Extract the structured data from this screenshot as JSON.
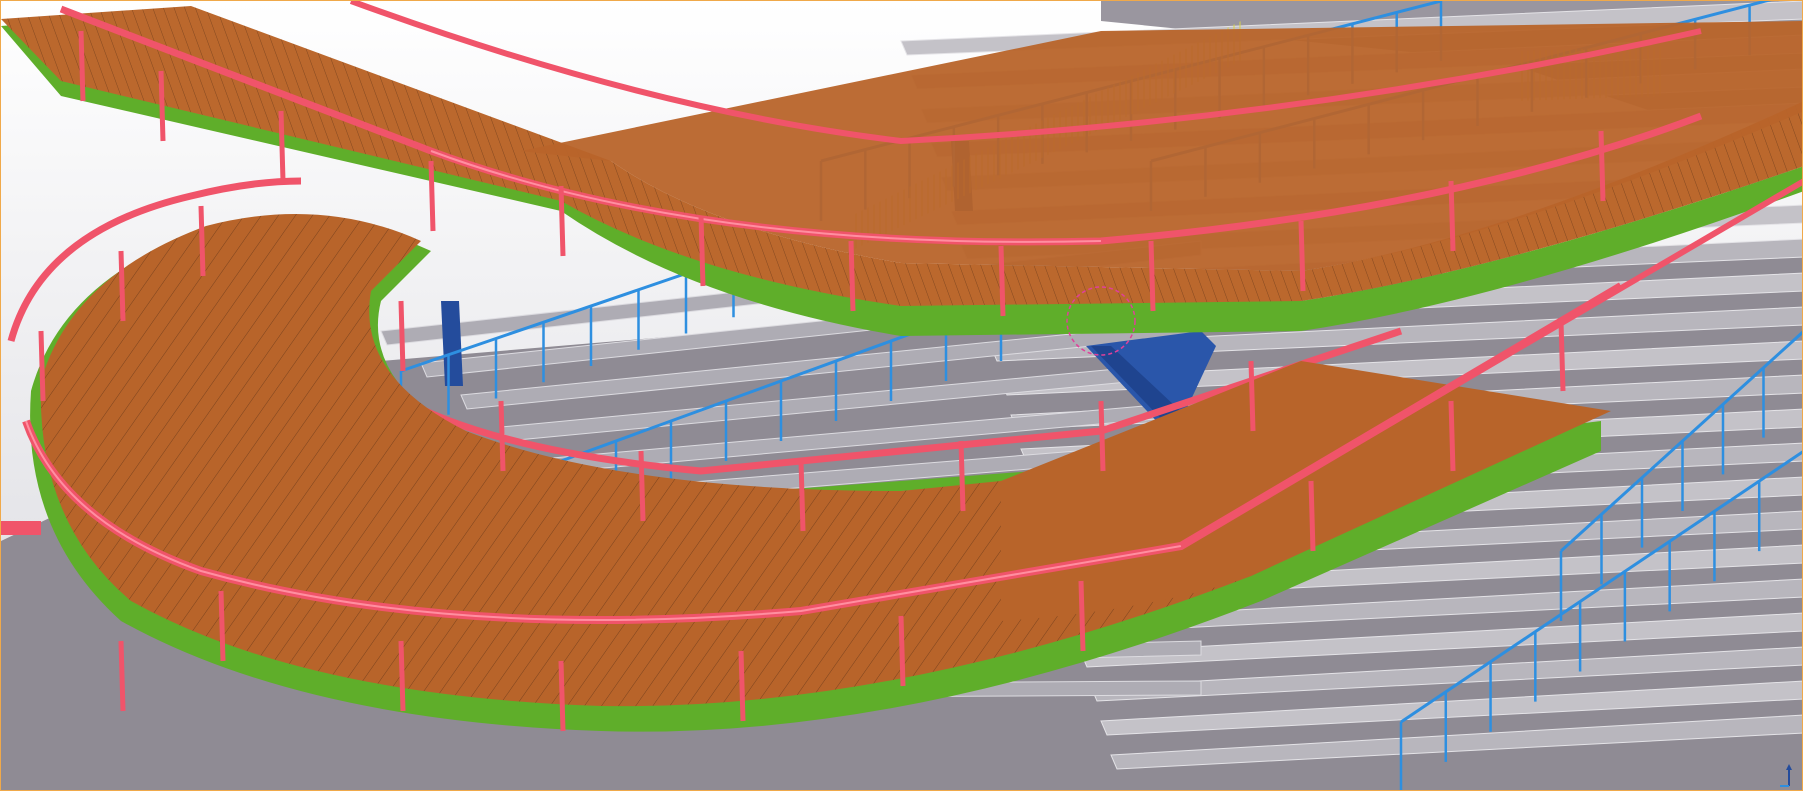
{
  "app": {
    "view": "3d-model-viewport"
  },
  "colors": {
    "background_top": "#ffffff",
    "background_bottom": "#d8d8de",
    "floor": "#8f8b94",
    "stair_tread": "#b8b6bd",
    "stair_riser": "#cfcdd3",
    "stair_nosing": "#e4e3e7",
    "deck_wood": "#b8642a",
    "deck_wood_light": "#c8773a",
    "deck_grid": "#6b3a1a",
    "edge_beam_green": "#5fae2a",
    "edge_beam_dark_green": "#3f8a1e",
    "handrail_red": "#f0546a",
    "handrail_highlight": "#ff8fa0",
    "balustrade_blue": "#2e8fe0",
    "infill_yellow": "#d8d24a",
    "column_navy": "#244c9c",
    "viewport_border": "#f0a94a",
    "selection_ring": "#e0409a"
  },
  "icons": {
    "axis": "axis-triad-icon",
    "selection": "selection-circle-icon"
  }
}
